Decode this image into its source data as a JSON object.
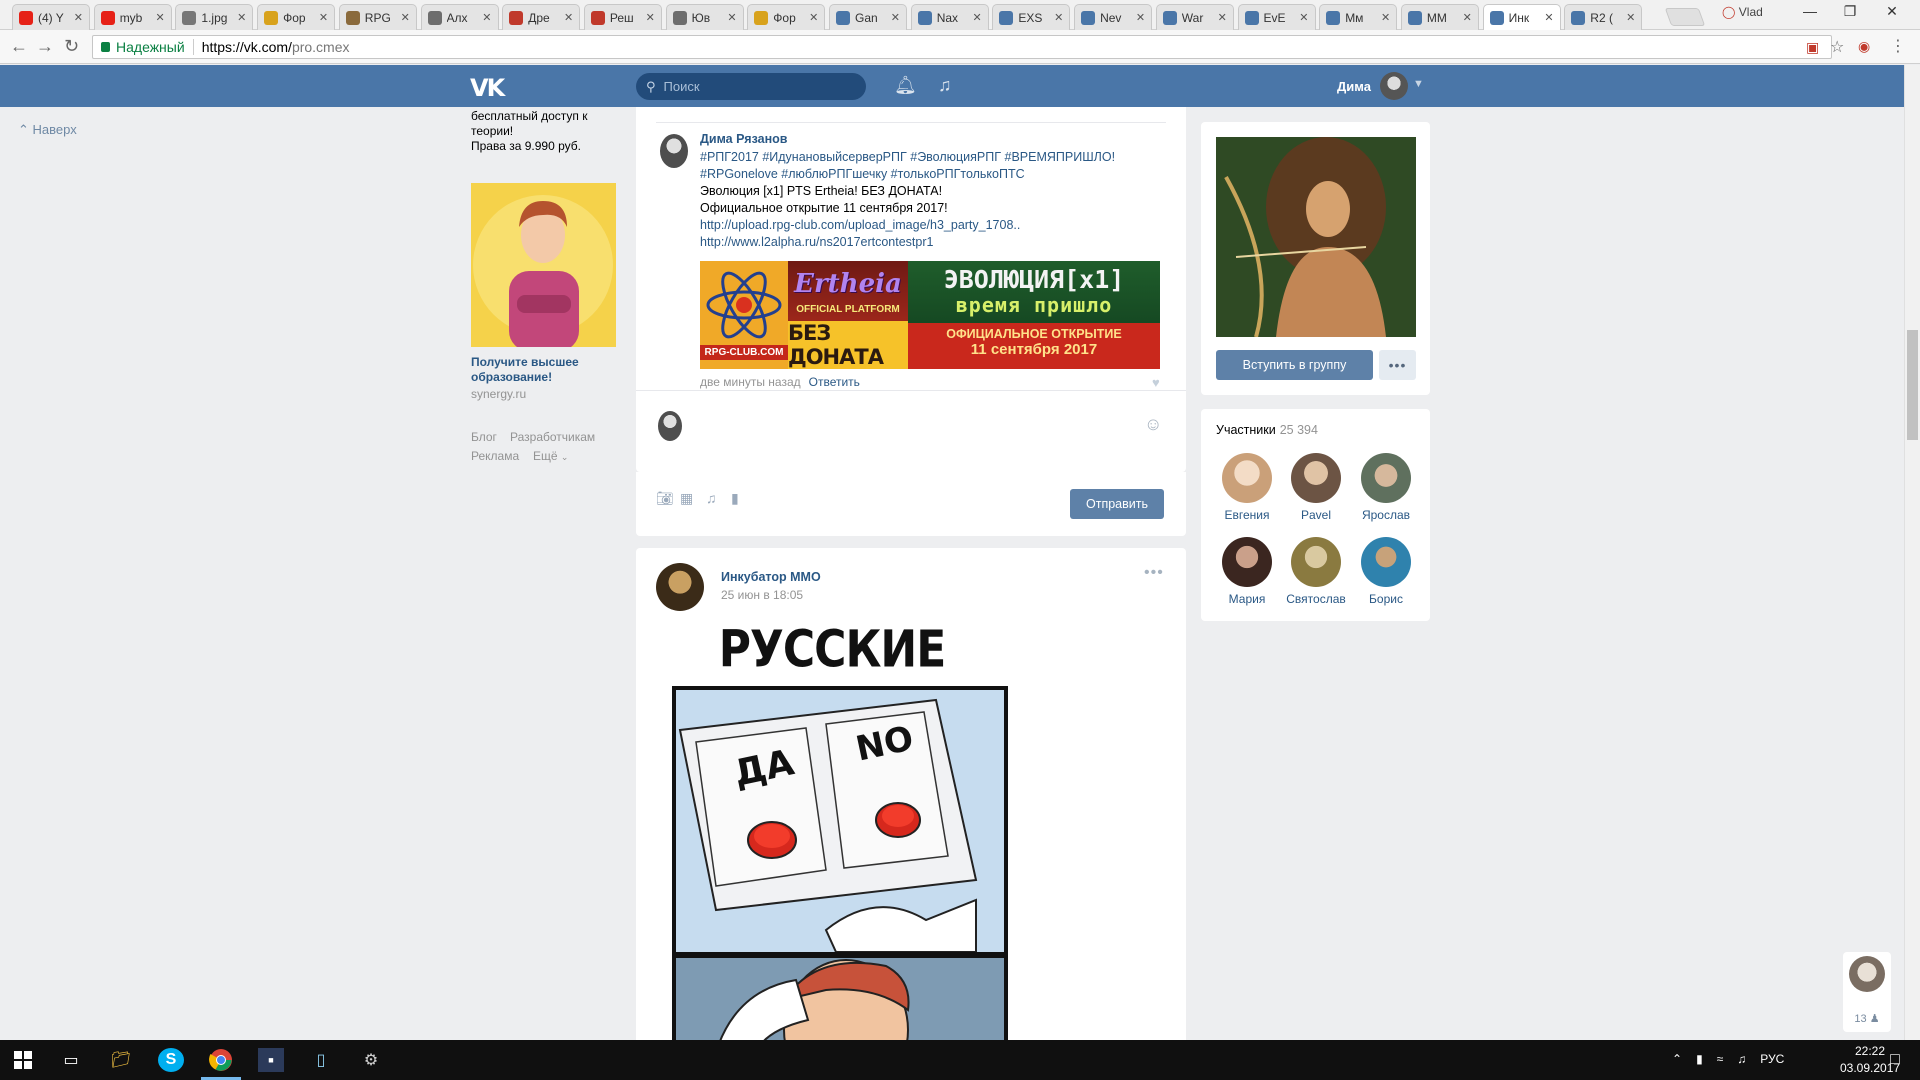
{
  "browser": {
    "tabs": [
      {
        "label": "(4) Y",
        "color": "#e62117"
      },
      {
        "label": "myb",
        "color": "#e62117"
      },
      {
        "label": "1.jpg",
        "color": "#777777"
      },
      {
        "label": "Фор",
        "color": "#d8a21c"
      },
      {
        "label": "RPG",
        "color": "#8a6a3c"
      },
      {
        "label": "Алх",
        "color": "#6d6d6d"
      },
      {
        "label": "Дре",
        "color": "#c0392b"
      },
      {
        "label": "Реш",
        "color": "#c0392b"
      },
      {
        "label": "Юв",
        "color": "#6d6d6d"
      },
      {
        "label": "Фор",
        "color": "#d8a21c"
      },
      {
        "label": "Gan",
        "color": "#4a76a8"
      },
      {
        "label": "Nax",
        "color": "#4a76a8"
      },
      {
        "label": "EXS",
        "color": "#4a76a8"
      },
      {
        "label": "Nev",
        "color": "#4a76a8"
      },
      {
        "label": "War",
        "color": "#4a76a8"
      },
      {
        "label": "EvE",
        "color": "#4a76a8"
      },
      {
        "label": "Мм",
        "color": "#4a76a8"
      },
      {
        "label": "MM",
        "color": "#4a76a8"
      },
      {
        "label": "Инк",
        "color": "#4a76a8",
        "active": true
      },
      {
        "label": "R2 (",
        "color": "#4a76a8"
      }
    ],
    "profile_label": "Vlad",
    "secure_label": "Надежный",
    "url_host": "https://vk.com/",
    "url_path": "pro.cmex"
  },
  "vk": {
    "search_placeholder": "Поиск",
    "user_name": "Дима",
    "up_label": "Наверх",
    "ad": {
      "text": "бесплатный доступ к теории!\nПрава за 9.990 руб.",
      "title": "Получите высшее образование!",
      "site": "synergy.ru"
    },
    "footer": {
      "blog": "Блог",
      "devs": "Разработчикам",
      "ads": "Реклама",
      "more": "Ещё"
    },
    "comment": {
      "author": "Дима Рязанов",
      "hashtags": "#РПГ2017 #ИдунановыйсерверРПГ #ЭволюцияРПГ #ВРЕМЯПРИШЛО! #RPGonelove #люблюРПГшечку #толькоРПГтолькоПТС",
      "line1": "Эволюция [x1] PTS Ertheia! БЕЗ ДОНАТА!",
      "line2": "Официальное открытие 11 сентября 2017!",
      "link1": "http://upload.rpg-club.com/upload_image/h3_party_1708..",
      "link2": "http://www.l2alpha.ru/ns2017ertcontestpr1",
      "banner": {
        "logo_text": "RPG-CLUB.COM",
        "brand": "Ertheia",
        "official": "OFFICIAL PLATFORM",
        "no_donate": "БЕЗ ДОНАТА",
        "evolution": "ЭВОЛЮЦИЯ[x1]",
        "time_came": "время пришло",
        "opening": "ОФИЦИАЛЬНОЕ ОТКРЫТИЕ",
        "date": "11 сентября 2017"
      },
      "time": "две минуты назад",
      "reply": "Ответить",
      "send_label": "Отправить"
    },
    "post": {
      "author": "Инкубатор MMO",
      "date": "25 июн в 18:05",
      "meme_title": "РУССКИЕ ЕСТЬ?",
      "btn_yes": "ДА",
      "btn_no": "NO"
    },
    "group": {
      "join_label": "Вступить в группу"
    },
    "members": {
      "title": "Участники",
      "count": "25 394",
      "list": [
        {
          "name": "Евгения",
          "color": "#e8c9b0"
        },
        {
          "name": "Pavel",
          "color": "#8b6a55"
        },
        {
          "name": "Ярослав",
          "color": "#6b7d6a"
        },
        {
          "name": "Мария",
          "color": "#5a3a2e"
        },
        {
          "name": "Святослав",
          "color": "#9a8a4c"
        },
        {
          "name": "Борис",
          "color": "#3f8fb5"
        }
      ]
    },
    "chat_count": "13"
  },
  "taskbar": {
    "lang": "РУС",
    "time": "22:22",
    "date": "03.09.2017"
  }
}
